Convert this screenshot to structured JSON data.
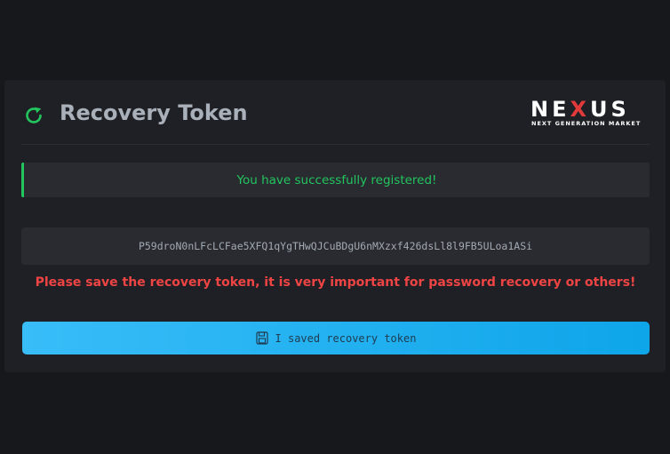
{
  "header": {
    "title": "Recovery Token",
    "refresh_icon": "refresh-icon",
    "logo": {
      "word_pre": "NE",
      "word_x": "X",
      "word_post": "US",
      "tagline": "NEXT GENERATION MARKET"
    }
  },
  "alert": {
    "message": "You have successfully registered!",
    "color": "#22c55e"
  },
  "token": {
    "value": "P59droN0nLFcLCFae5XFQ1qYgTHwQJCuBDgU6nMXzxf426dsLl8l9FB5ULoa1ASi"
  },
  "warning": {
    "text": "Please save the recovery token, it is very important for password recovery or others!",
    "color": "#ef4444"
  },
  "button": {
    "label": "I saved recovery token",
    "icon": "floppy-disk-icon",
    "color": "#38bdf8"
  }
}
